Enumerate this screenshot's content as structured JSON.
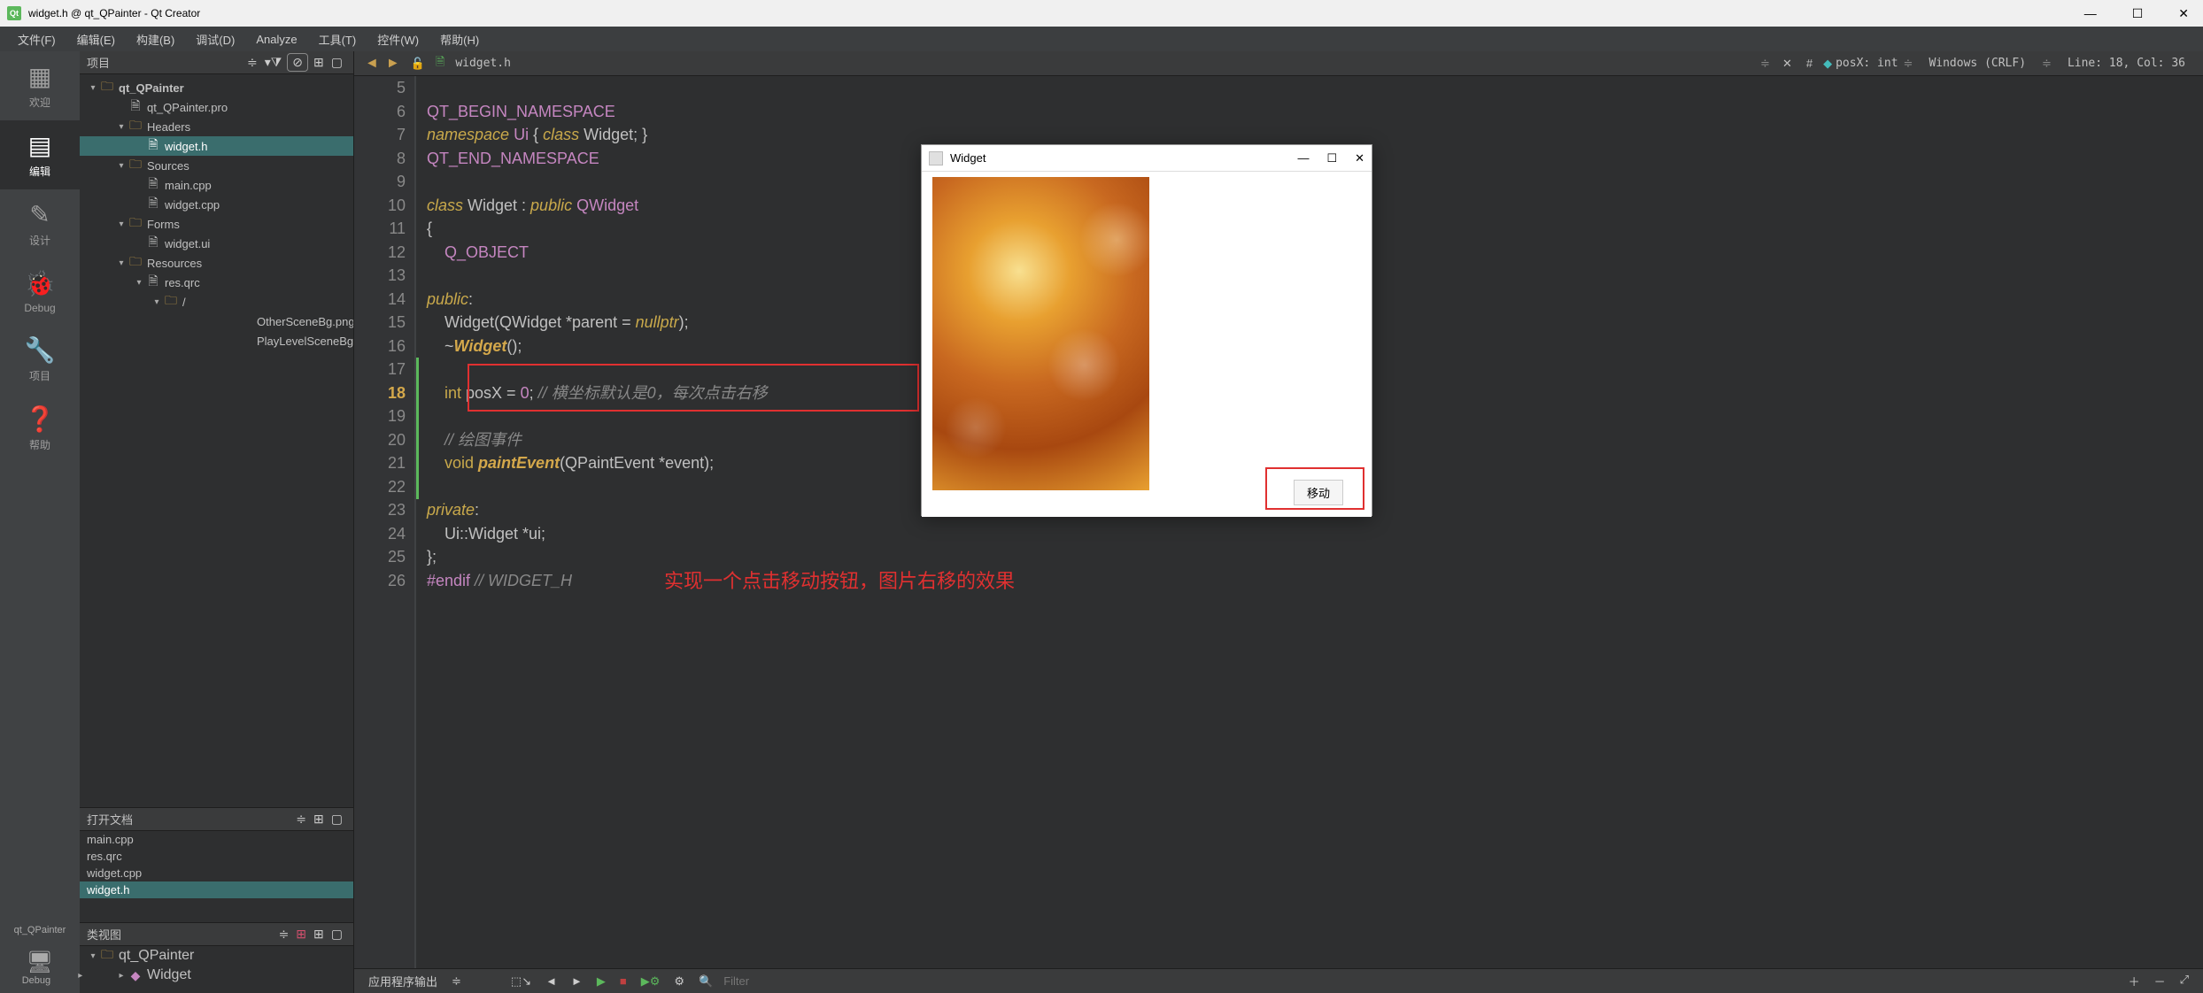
{
  "titlebar": {
    "title": "widget.h @ qt_QPainter - Qt Creator"
  },
  "menu": {
    "file": "文件(F)",
    "edit": "编辑(E)",
    "build": "构建(B)",
    "debug": "调试(D)",
    "analyze": "Analyze",
    "tools": "工具(T)",
    "widgets": "控件(W)",
    "help": "帮助(H)"
  },
  "mode": {
    "welcome": "欢迎",
    "edit": "编辑",
    "design": "设计",
    "debug": "Debug",
    "projects": "项目",
    "help": "帮助",
    "kit": "qt_QPainter",
    "run": "Debug"
  },
  "panels": {
    "project": "项目",
    "opendocs": "打开文档",
    "classview": "类视图"
  },
  "tree": {
    "root": "qt_QPainter",
    "pro": "qt_QPainter.pro",
    "headers": "Headers",
    "widget_h": "widget.h",
    "sources": "Sources",
    "main_cpp": "main.cpp",
    "widget_cpp": "widget.cpp",
    "forms": "Forms",
    "widget_ui": "widget.ui",
    "resources": "Resources",
    "res_qrc": "res.qrc",
    "slash": "/",
    "png1": "OtherSceneBg.png",
    "png2": "PlayLevelSceneBg.png"
  },
  "opendocs": {
    "f1": "main.cpp",
    "f2": "res.qrc",
    "f3": "widget.cpp",
    "f4": "widget.h"
  },
  "classview": {
    "root": "qt_QPainter",
    "widget": "Widget"
  },
  "edtoolbar": {
    "filename": "widget.h",
    "member": "posX: int",
    "encoding": "Windows (CRLF)",
    "linecol": "Line: 18, Col: 36"
  },
  "code": {
    "lines_start": 5,
    "lines_end": 26,
    "current": 18,
    "l6": "QT_BEGIN_NAMESPACE",
    "l7_ns": "namespace",
    "l7_ui": "Ui",
    "l7_rest": " { ",
    "l7_class": "class",
    "l7_w": " Widget; }",
    "l8": "QT_END_NAMESPACE",
    "l10_class": "class",
    "l10_name": " Widget : ",
    "l10_pub": "public",
    "l10_qw": " QWidget",
    "l11": "{",
    "l12": "    Q_OBJECT",
    "l14_pub": "public",
    "l14_colon": ":",
    "l15": "    Widget(QWidget *parent = ",
    "l15_null": "nullptr",
    "l15_end": ");",
    "l16_pre": "    ~",
    "l16_w": "Widget",
    "l16_end": "();",
    "l18_pre": "    ",
    "l18_int": "int",
    "l18_var": " posX = ",
    "l18_zero": "0",
    "l18_semi": "; ",
    "l18_cmt": "// 横坐标默认是0，每次点击右移",
    "l20_pre": "    ",
    "l20_cmt": "// 绘图事件",
    "l21_pre": "    ",
    "l21_void": "void ",
    "l21_fn": "paintEvent",
    "l21_args": "(QPaintEvent *event);",
    "l23_priv": "private",
    "l23_colon": ":",
    "l24": "    Ui::Widget *ui;",
    "l25": "};",
    "l26_endif": "#endif ",
    "l26_cmt": "// WIDGET_H",
    "annotation": "实现一个点击移动按钮，图片右移的效果"
  },
  "bottombar": {
    "output": "应用程序输出",
    "filter_placeholder": "Filter"
  },
  "popup": {
    "title": "Widget",
    "button": "移动"
  }
}
